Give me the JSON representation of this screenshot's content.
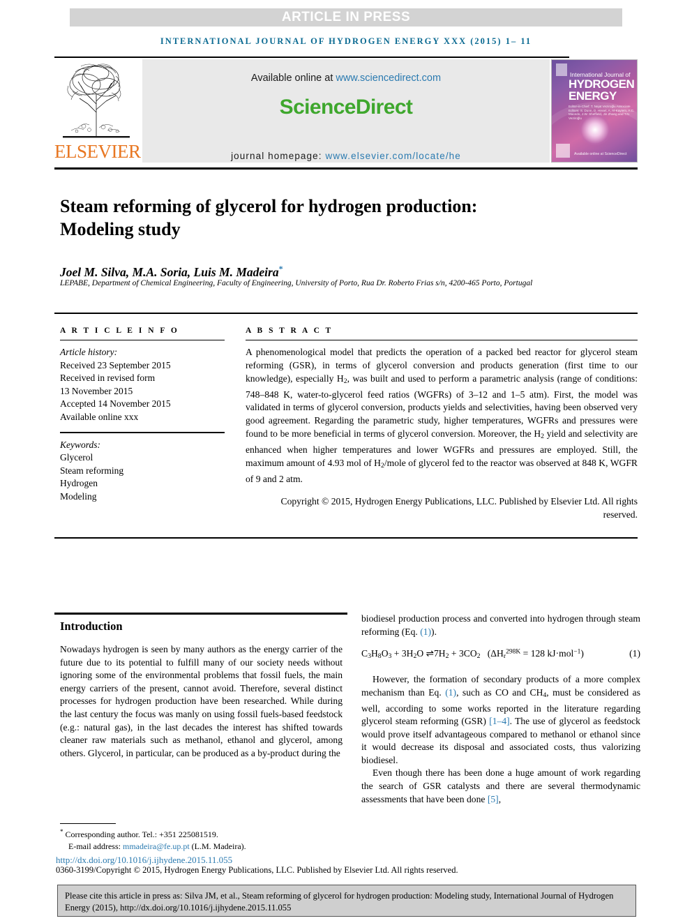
{
  "banner": {
    "text": "ARTICLE IN PRESS"
  },
  "running_head": "INTERNATIONAL JOURNAL OF HYDROGEN ENERGY XXX (2015) 1– 11",
  "masthead": {
    "available_prefix": "Available online at ",
    "available_url": "www.sciencedirect.com",
    "brand": "ScienceDirect",
    "homepage_prefix": "journal homepage: ",
    "homepage_url": "www.elsevier.com/locate/he",
    "publisher": "ELSEVIER",
    "cover": {
      "line_small": "International Journal of",
      "line1": "HYDROGEN",
      "line2": "ENERGY",
      "editors": "Editor-in-Chief:  T. Nejat Veziroğlu   Associate Editors: S. Dunn, D. Hissel, A. Al-Kayiem, A.C. Macedo, J.W. Sheffield, Jin Zhang and T.N. Veziroğlu",
      "footer": "Available online at ScienceDirect"
    }
  },
  "article": {
    "title": "Steam reforming of glycerol for hydrogen production: Modeling study",
    "authors": "Joel M. Silva, M.A. Soria, Luis M. Madeira",
    "author_marker": "*",
    "affiliation": "LEPABE, Department of Chemical Engineering, Faculty of Engineering, University of Porto, Rua Dr. Roberto Frias s/n, 4200-465 Porto, Portugal"
  },
  "info": {
    "label": "A R T I C L E   I N F O",
    "history_label": "Article history:",
    "history": [
      "Received 23 September 2015",
      "Received in revised form",
      "13 November 2015",
      "Accepted 14 November 2015",
      "Available online xxx"
    ],
    "keywords_label": "Keywords:",
    "keywords": [
      "Glycerol",
      "Steam reforming",
      "Hydrogen",
      "Modeling"
    ]
  },
  "abstract": {
    "label": "A B S T R A C T",
    "paragraph_1": "A phenomenological model that predicts the operation of a packed bed reactor for glycerol steam reforming (GSR), in terms of glycerol conversion and products generation (first time to our knowledge), especially H",
    "paragraph_1b": ", was built and used to perform a parametric analysis (range of conditions: 748–848 K, water-to-glycerol feed ratios (WGFRs) of 3–12 and 1–5 atm). First, the model was validated in terms of glycerol conversion, products yields and selectivities, having been observed very good agreement. Regarding the parametric study, higher temperatures, WGFRs and pressures were found to be more beneficial in terms of glycerol conversion. Moreover, the H",
    "paragraph_1c": " yield and selectivity are enhanced when higher temperatures and lower WGFRs and pressures are employed. Still, the maximum amount of 4.93 mol of H",
    "paragraph_1d": "/mole of glycerol fed to the reactor was observed at 848 K, WGFR of 9 and 2 atm.",
    "copyright": "Copyright © 2015, Hydrogen Energy Publications, LLC. Published by Elsevier Ltd. All rights reserved."
  },
  "body": {
    "section_heading": "Introduction",
    "left_p1": "Nowadays hydrogen is seen by many authors as the energy carrier of the future due to its potential to fulfill many of our society needs without ignoring some of the environmental problems that fossil fuels, the main energy carriers of the present, cannot avoid. Therefore, several distinct processes for hydrogen production have been researched. While during the last century the focus was manly on using fossil fuels-based feedstock (e.g.: natural gas), in the last decades the interest has shifted towards cleaner raw materials such as methanol, ethanol and glycerol, among others. Glycerol, in particular, can be produced as a by-product during the",
    "right_p1a": "biodiesel production process and converted into hydrogen through steam reforming (Eq. ",
    "right_p1_ref": "(1)",
    "right_p1b": ").",
    "equation": {
      "reactants": "C3H8O3 + 3H2O",
      "arrow": "⇌",
      "products": "7H2 + 3CO2",
      "enthalpy_open": "(ΔH",
      "enthalpy_sub": "r",
      "enthalpy_sup": "298K",
      "enthalpy_value": " = 128  kJ·mol",
      "enthalpy_unit_sup": "−1",
      "enthalpy_close": ")",
      "number": "(1)"
    },
    "right_p2a": "However, the formation of secondary products of a more complex mechanism than Eq. ",
    "right_p2_ref1": "(1)",
    "right_p2b": ", such as CO and CH",
    "right_p2_sub": "4",
    "right_p2c": ", must be considered as well, according to some works reported in the literature regarding glycerol steam reforming (GSR) ",
    "right_p2_ref2": "[1–4]",
    "right_p2d": ". The use of glycerol as feedstock would prove itself advantageous compared to methanol or ethanol since it would decrease its disposal and associated costs, thus valorizing biodiesel.",
    "right_p3a": "Even though there has been done a huge amount of work regarding the search of GSR catalysts and there are several thermodynamic assessments that have been done ",
    "right_p3_ref": "[5]",
    "right_p3b": ","
  },
  "footer": {
    "corresponding_marker": "*",
    "corresponding": " Corresponding author. Tel.: +351 225081519.",
    "email_label": "E-mail address: ",
    "email": "mmadeira@fe.up.pt",
    "email_suffix": " (L.M. Madeira).",
    "doi": "http://dx.doi.org/10.1016/j.ijhydene.2015.11.055",
    "issn_copyright": "0360-3199/Copyright © 2015, Hydrogen Energy Publications, LLC. Published by Elsevier Ltd. All rights reserved.",
    "citation": "Please cite this article in press as: Silva JM, et al., Steam reforming of glycerol for hydrogen production: Modeling study, International Journal of Hydrogen Energy (2015), http://dx.doi.org/10.1016/j.ijhydene.2015.11.055"
  },
  "colors": {
    "banner_bg": "#d3d3d3",
    "link": "#2a7ab0",
    "sciencedirect_green": "#3ea72d",
    "elsevier_orange": "#e87722",
    "running_head": "#0b6a92",
    "citation_bg": "#cfcfcf"
  }
}
